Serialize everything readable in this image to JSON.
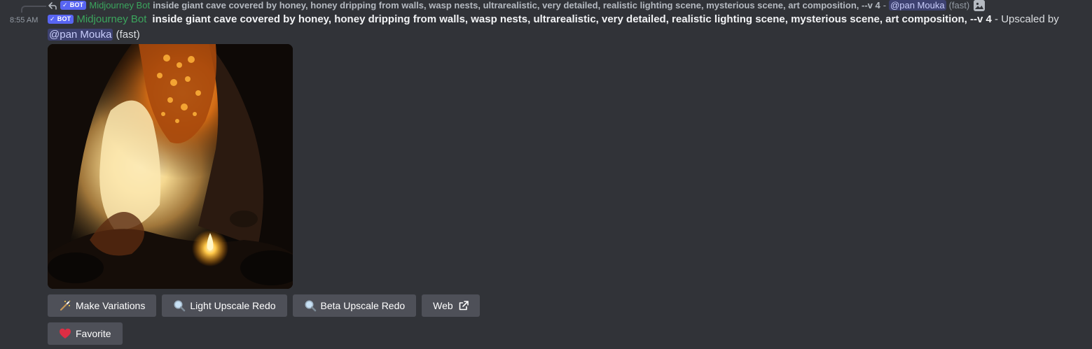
{
  "reply": {
    "badge": "BOT",
    "author": "Midjourney Bot",
    "prompt": "inside giant cave covered by honey, honey dripping from walls, wasp nests, ultrarealistic, very detailed, realistic lighting scene, mysterious scene, art composition, --v 4",
    "separator": "-",
    "mention": "@pan Mouka",
    "speed": "(fast)",
    "icon": "image-icon"
  },
  "message": {
    "timestamp": "8:55 AM",
    "badge": "BOT",
    "author": "Midjourney Bot",
    "prompt": "inside giant cave covered by honey, honey dripping from walls, wasp nests, ultrarealistic, very detailed, realistic lighting scene, mysterious scene, art composition, --v 4",
    "suffix": " - Upscaled by ",
    "mention": "@pan Mouka",
    "speed": "(fast)"
  },
  "buttons_row1": [
    {
      "label": "Make Variations",
      "icon": "magic-wand-icon"
    },
    {
      "label": "Light Upscale Redo",
      "icon": "magnifying-glass-icon"
    },
    {
      "label": "Beta Upscale Redo",
      "icon": "magnifying-glass-icon"
    },
    {
      "label": "Web",
      "icon": "external-link-icon"
    }
  ],
  "buttons_row2": [
    {
      "label": "Favorite",
      "icon": "heart-icon"
    }
  ],
  "colors": {
    "background": "#313338",
    "button": "#4e5058",
    "bot_badge": "#5865f2",
    "author": "#3ba55d",
    "mention_bg": "#5865f24d",
    "heart": "#dd2e44"
  }
}
